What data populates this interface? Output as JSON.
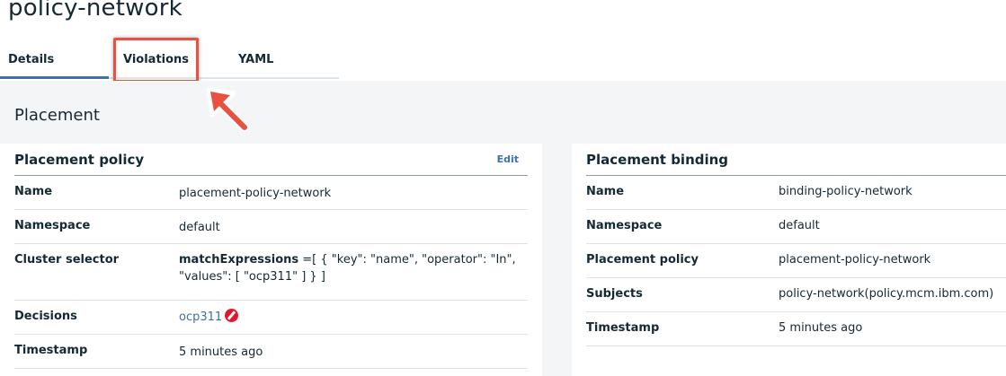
{
  "page": {
    "title": "policy-network"
  },
  "tabs": [
    {
      "label": "Details"
    },
    {
      "label": "Violations"
    },
    {
      "label": "YAML"
    }
  ],
  "section": {
    "title": "Placement"
  },
  "placement_policy": {
    "header": "Placement policy",
    "edit_label": "Edit",
    "rows": {
      "name": {
        "key": "Name",
        "value": "placement-policy-network"
      },
      "namespace": {
        "key": "Namespace",
        "value": "default"
      },
      "cluster_selector": {
        "key": "Cluster selector",
        "bold_part": "matchExpressions",
        "rest": " =[ { \"key\": \"name\", \"operator\": \"In\", \"values\": [ \"ocp311\" ] } ]"
      },
      "decisions": {
        "key": "Decisions",
        "value": "ocp311"
      },
      "timestamp": {
        "key": "Timestamp",
        "value": "5 minutes ago"
      }
    }
  },
  "placement_binding": {
    "header": "Placement binding",
    "rows": {
      "name": {
        "key": "Name",
        "value": "binding-policy-network"
      },
      "namespace": {
        "key": "Namespace",
        "value": "default"
      },
      "placement_policy": {
        "key": "Placement policy",
        "value": "placement-policy-network"
      },
      "subjects": {
        "key": "Subjects",
        "value": "policy-network(policy.mcm.ibm.com)"
      },
      "timestamp": {
        "key": "Timestamp",
        "value": "5 minutes ago"
      }
    }
  },
  "colors": {
    "accent": "#3d70b2",
    "highlight": "#e8503f",
    "deny": "#e0182d",
    "background": "#f4f5f7"
  },
  "icons": {
    "decision_status": "deny-icon",
    "annotation": "arrow-icon"
  }
}
